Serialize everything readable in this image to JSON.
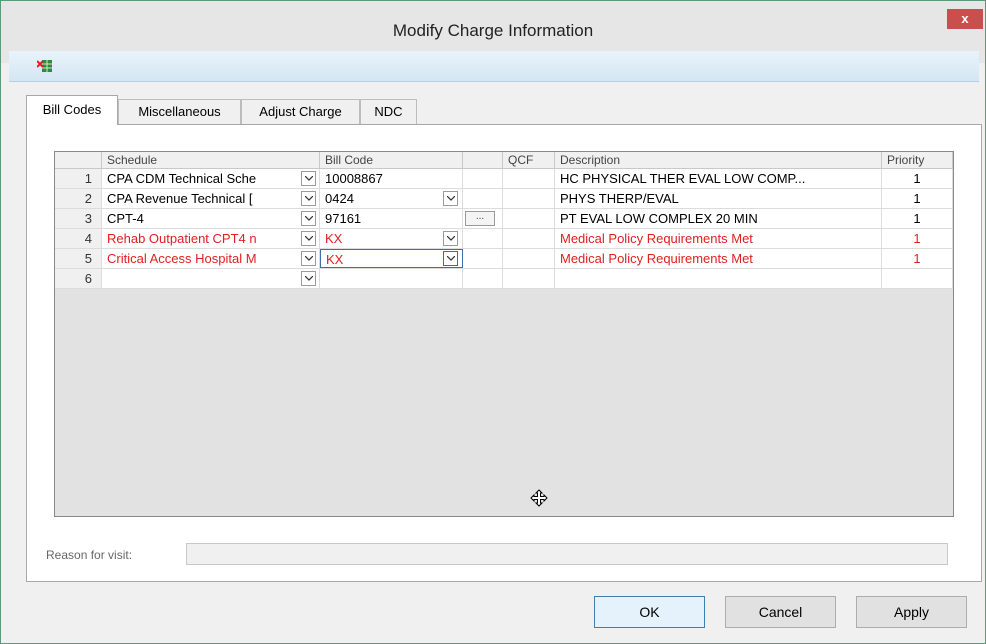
{
  "window": {
    "title": "Modify Charge Information",
    "close_label": "x"
  },
  "toolbar": {
    "icon": "grid-delete-icon"
  },
  "tabs": [
    {
      "label": "Bill Codes",
      "active": true
    },
    {
      "label": "Miscellaneous",
      "active": false
    },
    {
      "label": "Adjust Charge",
      "active": false
    },
    {
      "label": "NDC",
      "active": false
    }
  ],
  "grid": {
    "columns": {
      "schedule": "Schedule",
      "bill_code": "Bill Code",
      "qcf": "QCF",
      "description": "Description",
      "priority": "Priority"
    },
    "rows": [
      {
        "num": "1",
        "schedule": "CPA CDM Technical Sche",
        "bill_code": "10008867",
        "description": "HC PHYSICAL THER EVAL LOW COMP...",
        "priority": "1",
        "red": false
      },
      {
        "num": "2",
        "schedule": "CPA Revenue Technical [",
        "bill_code": "0424",
        "description": "PHYS THERP/EVAL",
        "priority": "1",
        "red": false
      },
      {
        "num": "3",
        "schedule": "CPT-4",
        "bill_code": "97161",
        "description": "PT EVAL LOW COMPLEX 20 MIN",
        "priority": "1",
        "red": false,
        "ellipsis": "..."
      },
      {
        "num": "4",
        "schedule": "Rehab Outpatient CPT4 n",
        "bill_code": "KX",
        "description": "Medical Policy Requirements Met",
        "priority": "1",
        "red": true
      },
      {
        "num": "5",
        "schedule": "Critical Access Hospital M",
        "bill_code": "KX",
        "description": "Medical Policy Requirements Met",
        "priority": "1",
        "red": true
      },
      {
        "num": "6",
        "schedule": "",
        "bill_code": "",
        "description": "",
        "priority": "",
        "red": false
      }
    ]
  },
  "reason": {
    "label": "Reason for visit:",
    "value": ""
  },
  "buttons": {
    "ok": "OK",
    "cancel": "Cancel",
    "apply": "Apply"
  },
  "colors": {
    "error_red": "#e02020",
    "grid_empty": "#e2e2e2",
    "title_bar": "#e6e6e6"
  }
}
